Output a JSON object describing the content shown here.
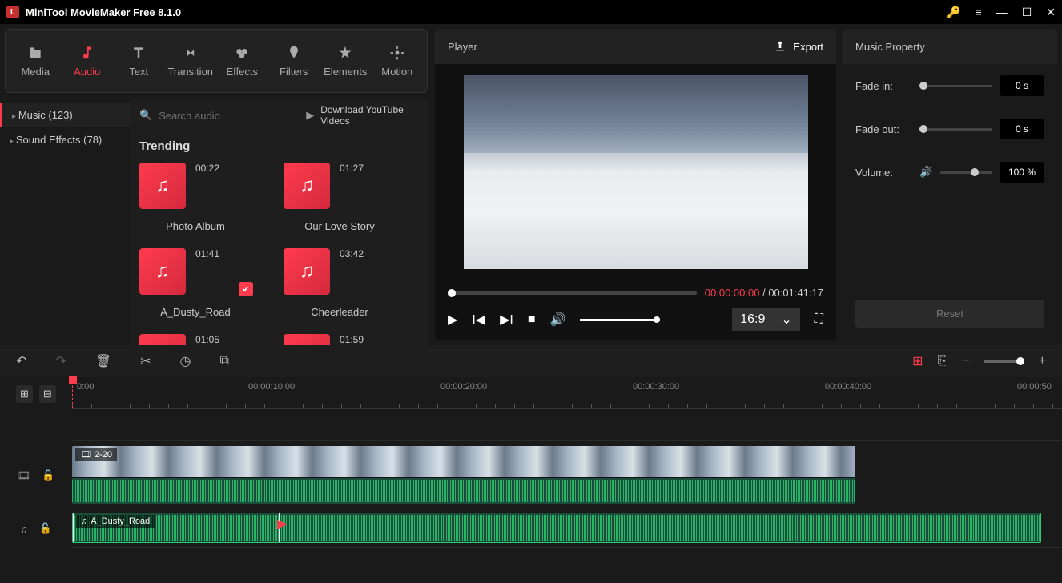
{
  "app": {
    "title": "MiniTool MovieMaker Free 8.1.0"
  },
  "toolbar": {
    "items": [
      {
        "label": "Media"
      },
      {
        "label": "Audio"
      },
      {
        "label": "Text"
      },
      {
        "label": "Transition"
      },
      {
        "label": "Effects"
      },
      {
        "label": "Filters"
      },
      {
        "label": "Elements"
      },
      {
        "label": "Motion"
      }
    ]
  },
  "categories": {
    "music": "Music (123)",
    "sfx": "Sound Effects (78)"
  },
  "search": {
    "placeholder": "Search audio",
    "download": "Download YouTube Videos"
  },
  "section": {
    "trending": "Trending"
  },
  "tracks": [
    {
      "dur": "00:22",
      "name": "Photo Album"
    },
    {
      "dur": "01:27",
      "name": "Our Love Story"
    },
    {
      "dur": "01:41",
      "name": "A_Dusty_Road",
      "selected": true
    },
    {
      "dur": "03:42",
      "name": "Cheerleader"
    },
    {
      "dur": "01:05",
      "name": ""
    },
    {
      "dur": "01:59",
      "name": ""
    }
  ],
  "player": {
    "title": "Player",
    "export": "Export",
    "current": "00:00:00:00",
    "total": "00:01:41:17",
    "aspect": "16:9"
  },
  "props": {
    "title": "Music Property",
    "fadein": {
      "label": "Fade in:",
      "value": "0 s"
    },
    "fadeout": {
      "label": "Fade out:",
      "value": "0 s"
    },
    "volume": {
      "label": "Volume:",
      "value": "100 %"
    },
    "reset": "Reset"
  },
  "ruler": {
    "t0": "0:00",
    "t1": "00:00:10:00",
    "t2": "00:00:20:00",
    "t3": "00:00:30:00",
    "t4": "00:00:40:00",
    "t5": "00:00:50"
  },
  "timeline": {
    "videoClip": "2-20",
    "audioClip": "A_Dusty_Road"
  }
}
